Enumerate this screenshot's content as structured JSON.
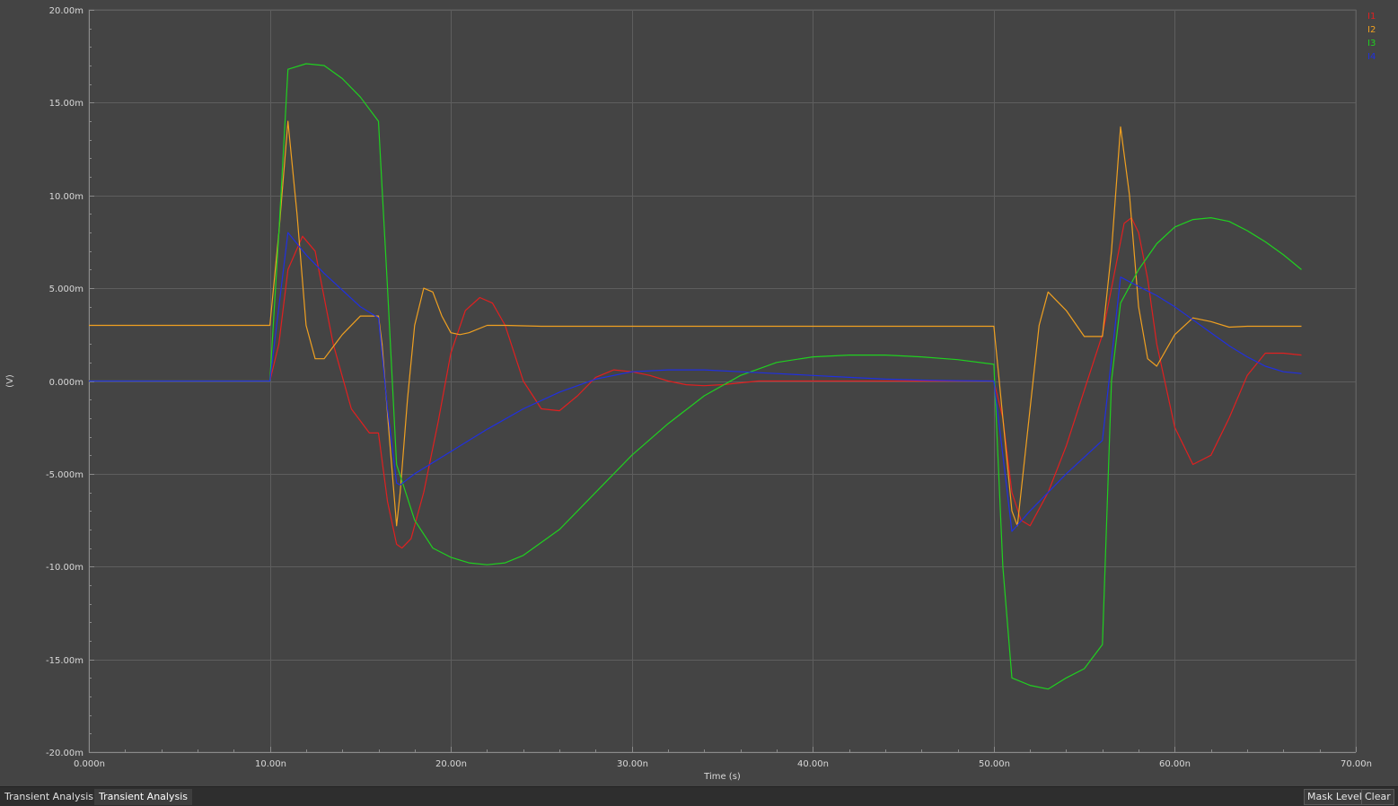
{
  "chart_data": {
    "type": "line",
    "xlabel": "Time (s)",
    "ylabel": "(V)",
    "xlim": [
      0,
      70
    ],
    "ylim": [
      -20,
      20
    ],
    "x_unit": "ns",
    "y_unit": "mV",
    "xticks": [
      0,
      10,
      20,
      30,
      40,
      50,
      60,
      70
    ],
    "xtick_labels": [
      "0.000n",
      "10.00n",
      "20.00n",
      "30.00n",
      "40.00n",
      "50.00n",
      "60.00n",
      "70.00n"
    ],
    "yticks": [
      20,
      15,
      10,
      5,
      0,
      -5,
      -10,
      -15,
      -20
    ],
    "ytick_labels": [
      "20.00m",
      "15.00m",
      "10.00m",
      "5.000m",
      "0.000m",
      "-5.000m",
      "-10.00m",
      "-15.00m",
      "-20.00m"
    ],
    "grid": true,
    "legend_position": "top-right",
    "colors": {
      "background": "#444444",
      "grid": "#5e5e5e",
      "axis": "#8a8a8a"
    },
    "series": [
      {
        "name": "I1",
        "color": "#e02020",
        "x": [
          0,
          10,
          10.5,
          11,
          11.8,
          12.5,
          13.5,
          14.5,
          15.5,
          16,
          16.5,
          17,
          17.3,
          17.8,
          18.5,
          19.3,
          20,
          20.8,
          21.6,
          22.3,
          23,
          24,
          25,
          26,
          27,
          28,
          29,
          30,
          31,
          32,
          33,
          34,
          35,
          37,
          40,
          43,
          46,
          50,
          50.5,
          51,
          51.5,
          52,
          53,
          54,
          55,
          56,
          56.5,
          57.2,
          57.6,
          58,
          58.5,
          59,
          60,
          61,
          62,
          63,
          64,
          65,
          66,
          67
        ],
        "y": [
          0,
          0,
          2,
          6,
          7.8,
          7,
          2,
          -1.5,
          -2.8,
          -2.8,
          -6.5,
          -8.8,
          -9,
          -8.5,
          -6,
          -2.2,
          1.5,
          3.8,
          4.5,
          4.2,
          3,
          0,
          -1.5,
          -1.6,
          -0.8,
          0.2,
          0.6,
          0.5,
          0.3,
          0,
          -0.2,
          -0.25,
          -0.2,
          0,
          0,
          0,
          0,
          0,
          -2,
          -6,
          -7.5,
          -7.8,
          -6,
          -3.5,
          -0.5,
          2.5,
          5,
          8.5,
          8.8,
          8,
          5.5,
          2,
          -2.5,
          -4.5,
          -4,
          -2,
          0.3,
          1.5,
          1.5,
          1.4
        ]
      },
      {
        "name": "I2",
        "color": "#f0a020",
        "x": [
          0,
          10,
          10.5,
          11,
          11.5,
          12,
          12.5,
          13,
          14,
          15,
          16,
          16.2,
          16.6,
          17,
          17.2,
          17.6,
          18,
          18.5,
          19,
          19.5,
          20,
          20.5,
          21,
          22,
          23,
          25,
          30,
          40,
          50,
          50.3,
          51,
          51.3,
          52,
          52.5,
          53,
          54,
          55,
          56,
          56.5,
          57,
          57.5,
          58,
          58.5,
          59,
          60,
          61,
          62,
          63,
          64,
          65,
          67
        ],
        "y": [
          3,
          3,
          8,
          14,
          9,
          3,
          1.2,
          1.2,
          2.5,
          3.5,
          3.5,
          2,
          -3,
          -7.8,
          -6,
          -1,
          3,
          5,
          4.8,
          3.5,
          2.6,
          2.5,
          2.6,
          3,
          3,
          2.95,
          2.95,
          2.95,
          2.95,
          0,
          -7,
          -7.8,
          -1.5,
          3,
          4.8,
          3.8,
          2.4,
          2.4,
          7,
          13.7,
          10,
          4,
          1.2,
          0.8,
          2.5,
          3.4,
          3.2,
          2.9,
          2.95,
          2.95,
          2.95
        ]
      },
      {
        "name": "I3",
        "color": "#20d020",
        "x": [
          0,
          10,
          10.5,
          11,
          12,
          13,
          14,
          15,
          16,
          16.5,
          17,
          17.5,
          18,
          19,
          20,
          21,
          22,
          23,
          24,
          26,
          28,
          30,
          32,
          34,
          36,
          38,
          40,
          42,
          44,
          46,
          48,
          50,
          50.5,
          51,
          52,
          53,
          54,
          55,
          56,
          56.5,
          57,
          58,
          59,
          60,
          61,
          62,
          63,
          64,
          65,
          66,
          67
        ],
        "y": [
          0,
          0,
          8,
          16.8,
          17.1,
          17,
          16.3,
          15.3,
          14,
          5,
          -4.5,
          -6,
          -7.5,
          -9,
          -9.5,
          -9.8,
          -9.9,
          -9.8,
          -9.4,
          -8,
          -6,
          -4,
          -2.3,
          -0.8,
          0.3,
          1,
          1.3,
          1.4,
          1.4,
          1.3,
          1.15,
          0.9,
          -10,
          -16,
          -16.4,
          -16.6,
          -16,
          -15.5,
          -14.2,
          0,
          4.2,
          6,
          7.4,
          8.3,
          8.7,
          8.8,
          8.6,
          8.1,
          7.5,
          6.8,
          6
        ]
      },
      {
        "name": "I4",
        "color": "#2030e0",
        "x": [
          0,
          10,
          10.5,
          11,
          12,
          13,
          14,
          15,
          16,
          16.5,
          17,
          17.2,
          18,
          20,
          22,
          24,
          26,
          28,
          30,
          32,
          34,
          36,
          38,
          40,
          42,
          44,
          46,
          48,
          50,
          50.5,
          51,
          52,
          54,
          56,
          56.5,
          57,
          58,
          59,
          60,
          61,
          62,
          63,
          64,
          65,
          66,
          67
        ],
        "y": [
          0,
          0,
          4,
          8,
          6.8,
          5.8,
          4.9,
          4,
          3.4,
          -1.5,
          -5.5,
          -5.6,
          -5,
          -3.8,
          -2.6,
          -1.5,
          -0.6,
          0.1,
          0.5,
          0.6,
          0.6,
          0.5,
          0.4,
          0.3,
          0.2,
          0.1,
          0.05,
          0.02,
          0,
          -4,
          -8.1,
          -7,
          -5,
          -3.2,
          1.2,
          5.6,
          5.1,
          4.6,
          4,
          3.3,
          2.6,
          1.9,
          1.3,
          0.8,
          0.5,
          0.4
        ]
      }
    ]
  },
  "bottom_bar": {
    "tabs": [
      "Transient Analysis",
      "Transient Analysis"
    ],
    "mask_level_label": "Mask Level",
    "clear_label": "Clear"
  }
}
